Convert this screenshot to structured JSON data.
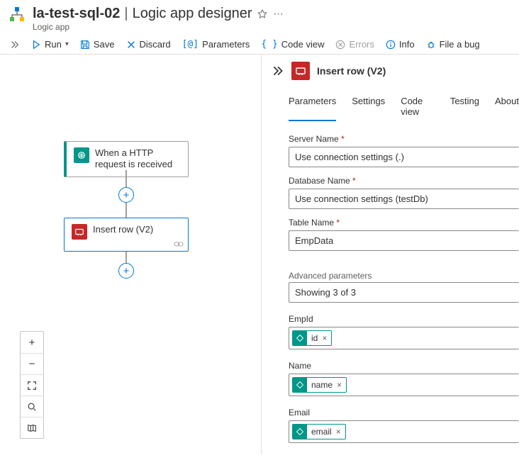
{
  "header": {
    "app_name": "la-test-sql-02",
    "page_name": "Logic app designer",
    "subtitle": "Logic app"
  },
  "toolbar": {
    "run": "Run",
    "save": "Save",
    "discard": "Discard",
    "parameters": "Parameters",
    "code_view": "Code view",
    "errors": "Errors",
    "info": "Info",
    "file_a_bug": "File a bug"
  },
  "canvas": {
    "trigger_label": "When a HTTP request is received",
    "action_label": "Insert row (V2)"
  },
  "panel": {
    "title": "Insert row (V2)",
    "tabs": {
      "parameters": "Parameters",
      "settings": "Settings",
      "code_view": "Code view",
      "testing": "Testing",
      "about": "About"
    },
    "fields": {
      "server_name_label": "Server Name",
      "server_name_value": "Use connection settings (.)",
      "database_name_label": "Database Name",
      "database_name_value": "Use connection settings (testDb)",
      "table_name_label": "Table Name",
      "table_name_value": "EmpData",
      "advanced_label": "Advanced parameters",
      "advanced_value": "Showing 3 of 3"
    },
    "params": {
      "empid_label": "EmpId",
      "empid_token": "id",
      "name_label": "Name",
      "name_token": "name",
      "email_label": "Email",
      "email_token": "email"
    }
  }
}
